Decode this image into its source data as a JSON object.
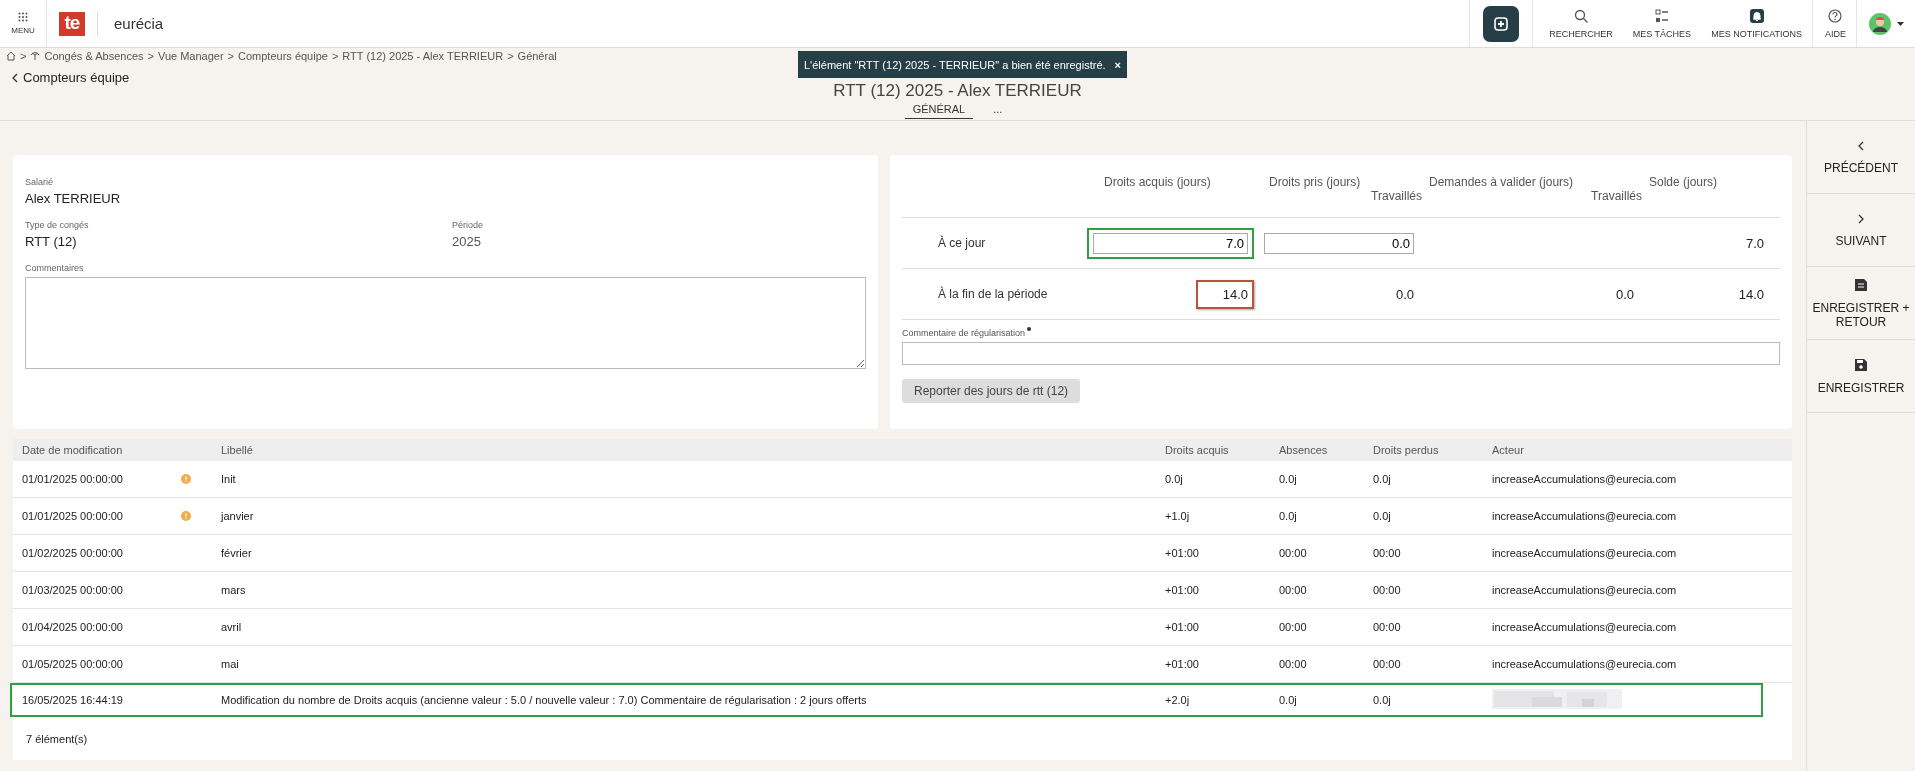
{
  "topbar": {
    "menu_label": "MENU",
    "logo_text": "te",
    "brand": "eurécia",
    "actions": [
      {
        "kind": "search",
        "label": "RECHERCHER"
      },
      {
        "kind": "tasks",
        "label": "MES TÂCHES"
      },
      {
        "kind": "notifications",
        "label": "MES NOTIFICATIONS"
      },
      {
        "kind": "help",
        "label": "AIDE"
      }
    ]
  },
  "breadcrumb_separator": ">",
  "breadcrumb": [
    "Congés & Absences",
    "Vue Manager",
    "Compteurs équipe",
    "RTT (12) 2025 - Alex TERRIEUR",
    "Général"
  ],
  "back_link": "Compteurs équipe",
  "page_title": "RTT (12) 2025 - Alex TERRIEUR",
  "toast": {
    "message": "L'élément \"RTT (12) 2025 - TERRIEUR\" a bien été enregistré.",
    "close": "×"
  },
  "tabs": [
    {
      "label": "GÉNÉRAL",
      "selected": true
    },
    {
      "label": "...",
      "selected": false
    }
  ],
  "info": {
    "employee_label": "Salarié",
    "employee": "Alex TERRIEUR",
    "type_label": "Type de congés",
    "type": "RTT (12)",
    "period_label": "Période",
    "period": "2025",
    "comments_label": "Commentaires"
  },
  "counters": {
    "columns": [
      {
        "title": "Droits acquis (jours)"
      },
      {
        "title": "Droits pris (jours)",
        "sub": "Travaillés"
      },
      {
        "title": "Demandes à valider (jours)",
        "sub": "Travaillés"
      },
      {
        "title": "Solde (jours)"
      }
    ],
    "rows": [
      {
        "label": "À ce jour",
        "cells": [
          {
            "kind": "input",
            "value": "7.0",
            "color": "#2ea043"
          },
          {
            "kind": "input",
            "value": "0.0"
          },
          {
            "kind": "blank"
          },
          {
            "kind": "text",
            "value": "7.0"
          }
        ]
      },
      {
        "label": "À la fin de la période",
        "cells": [
          {
            "kind": "text",
            "value": "14.0",
            "color": "#b5533c"
          },
          {
            "kind": "text",
            "value": "0.0"
          },
          {
            "kind": "text",
            "value": "0.0"
          },
          {
            "kind": "text",
            "value": "14.0"
          }
        ]
      }
    ],
    "comment_label": "Commentaire de régularisation",
    "comment_required": true,
    "button": "Reporter des jours de rtt (12)"
  },
  "history": {
    "columns": [
      "Date de modification",
      "Libellé",
      "Droits acquis",
      "Absences",
      "Droits perdus",
      "Acteur"
    ],
    "rows": [
      {
        "date": "01/01/2025 00:00:00",
        "warning": true,
        "label": "Init",
        "acquired": "0.0j",
        "absences": "0.0j",
        "lost": "0.0j",
        "actor": "increaseAccumulations@eurecia.com",
        "highlighted": false
      },
      {
        "date": "01/01/2025 00:00:00",
        "warning": true,
        "label": "janvier",
        "acquired": "+1.0j",
        "absences": "0.0j",
        "lost": "0.0j",
        "actor": "increaseAccumulations@eurecia.com",
        "highlighted": false
      },
      {
        "date": "01/02/2025 00:00:00",
        "warning": false,
        "label": "février",
        "acquired": "+01:00",
        "absences": "00:00",
        "lost": "00:00",
        "actor": "increaseAccumulations@eurecia.com",
        "highlighted": false
      },
      {
        "date": "01/03/2025 00:00:00",
        "warning": false,
        "label": "mars",
        "acquired": "+01:00",
        "absences": "00:00",
        "lost": "00:00",
        "actor": "increaseAccumulations@eurecia.com",
        "highlighted": false
      },
      {
        "date": "01/04/2025 00:00:00",
        "warning": false,
        "label": "avril",
        "acquired": "+01:00",
        "absences": "00:00",
        "lost": "00:00",
        "actor": "increaseAccumulations@eurecia.com",
        "highlighted": false
      },
      {
        "date": "01/05/2025 00:00:00",
        "warning": false,
        "label": "mai",
        "acquired": "+01:00",
        "absences": "00:00",
        "lost": "00:00",
        "actor": "increaseAccumulations@eurecia.com",
        "highlighted": false
      },
      {
        "date": "16/05/2025 16:44:19",
        "warning": false,
        "label": "Modification du nombre de Droits acquis (ancienne valeur : 5.0 / nouvelle valeur : 7.0) Commentaire de régularisation : 2 jours offerts",
        "acquired": "+2.0j",
        "absences": "0.0j",
        "lost": "0.0j",
        "actor_redacted": true,
        "highlighted": true
      }
    ],
    "count": "7 élément(s)"
  },
  "sidebar": [
    {
      "kind": "previous",
      "label": "PRÉCÉDENT"
    },
    {
      "kind": "next",
      "label": "SUIVANT"
    },
    {
      "kind": "save-return",
      "label": "ENREGISTRER + RETOUR"
    },
    {
      "kind": "save",
      "label": "ENREGISTRER"
    }
  ]
}
